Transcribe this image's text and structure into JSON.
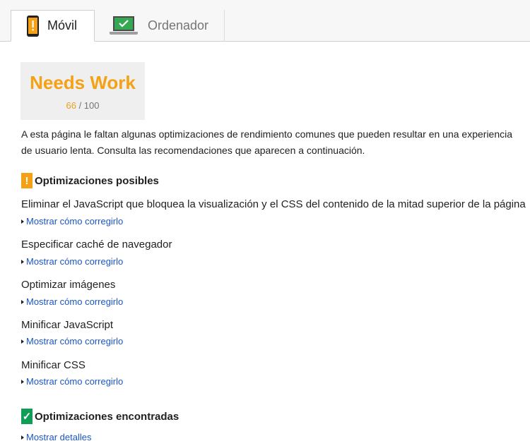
{
  "tabs": [
    {
      "label": "Móvil",
      "icon": "phone-warning-icon",
      "active": true
    },
    {
      "label": "Ordenador",
      "icon": "laptop-check-icon",
      "active": false
    }
  ],
  "score": {
    "title": "Needs Work",
    "value": "66",
    "max": "/ 100",
    "accent_color": "#f5a116"
  },
  "summary": "A esta página le faltan algunas optimizaciones de rendimiento comunes que pueden resultar en una experiencia de usuario lenta. Consulta las recomendaciones que aparecen a continuación.",
  "possible": {
    "badge": "!",
    "title": "Optimizaciones posibles",
    "rules": [
      {
        "title": "Eliminar el JavaScript que bloquea la visualización y el CSS del contenido de la mitad superior de la página",
        "link": "Mostrar cómo corregirlo"
      },
      {
        "title": "Especificar caché de navegador",
        "link": "Mostrar cómo corregirlo"
      },
      {
        "title": "Optimizar imágenes",
        "link": "Mostrar cómo corregirlo"
      },
      {
        "title": "Minificar JavaScript",
        "link": "Mostrar cómo corregirlo"
      },
      {
        "title": "Minificar CSS",
        "link": "Mostrar cómo corregirlo"
      }
    ]
  },
  "found": {
    "badge": "✓",
    "title": "Optimizaciones encontradas",
    "link": "Mostrar detalles"
  }
}
